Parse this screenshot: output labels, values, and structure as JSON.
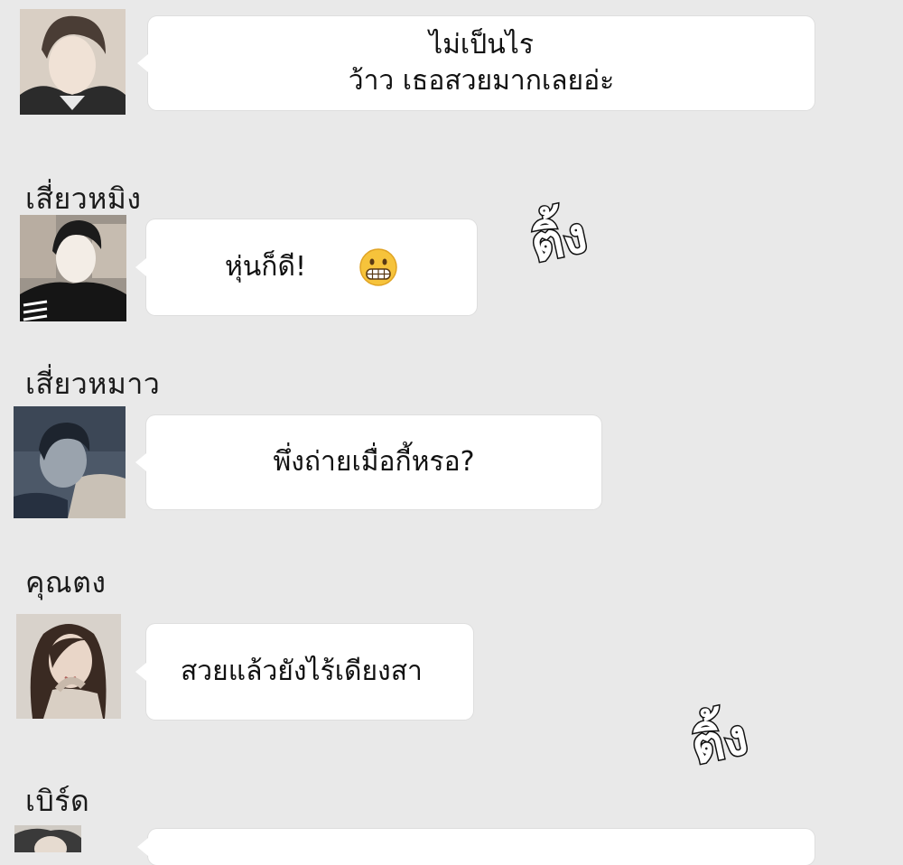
{
  "messages": [
    {
      "sender": "",
      "lines": [
        "ไม่เป็นไร",
        "ว้าว  เธอสวยมากเลยอ่ะ"
      ]
    },
    {
      "sender": "เสี่ยวหมิง",
      "lines": [
        "หุ่นก็ดี!"
      ],
      "emoji": "grimacing-emoji"
    },
    {
      "sender": "เสี่ยวหมาว",
      "lines": [
        "พึ่งถ่ายเมื่อกี้หรอ?"
      ]
    },
    {
      "sender": "คุณตง",
      "lines": [
        "สวยแล้วยังไร้เดียงสา"
      ]
    },
    {
      "sender": "เบิร์ด",
      "lines": [
        ""
      ]
    }
  ],
  "sound_effects": [
    "ติ้ง",
    "ติ้ง"
  ],
  "colors": {
    "background": "#e9e9e9",
    "bubble": "#ffffff",
    "text": "#111111"
  }
}
